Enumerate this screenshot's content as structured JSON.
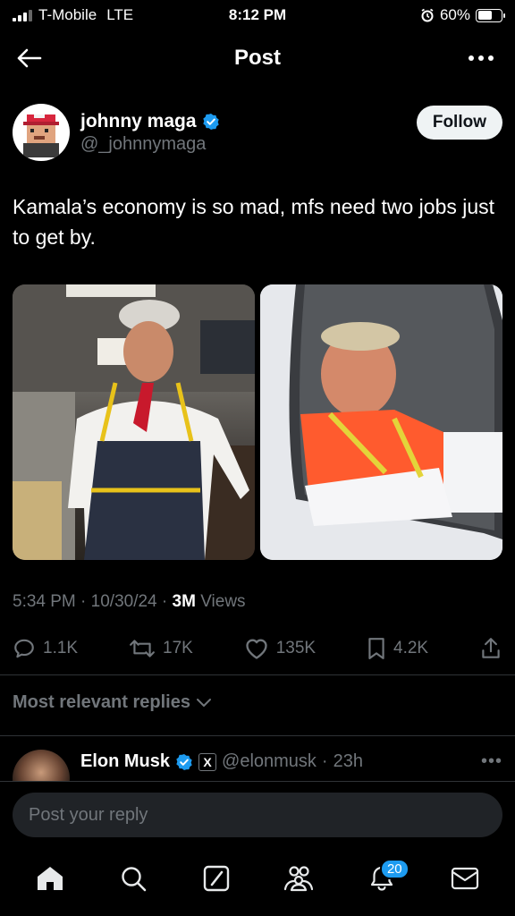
{
  "status_bar": {
    "carrier": "T-Mobile",
    "network": "LTE",
    "time": "8:12 PM",
    "battery": "60%",
    "battery_level": 0.6
  },
  "header": {
    "title": "Post",
    "back_icon": "arrow-left-icon",
    "more_icon": "more-horizontal-icon"
  },
  "author": {
    "name": "johnny maga",
    "handle": "@_johnnymaga",
    "verified": true,
    "follow_label": "Follow"
  },
  "post": {
    "text": "Kamala’s economy is so mad, mfs need two jobs just to get by.",
    "media_count": 2
  },
  "meta": {
    "time": "5:34 PM",
    "date": "10/30/24",
    "views_count": "3M",
    "views_label": "Views"
  },
  "actions": {
    "replies": "1.1K",
    "reposts": "17K",
    "likes": "135K",
    "bookmarks": "4.2K"
  },
  "replies_section": {
    "sort_label": "Most relevant replies"
  },
  "reply_preview": {
    "name": "Elon Musk",
    "handle": "@elonmusk",
    "age": "23h"
  },
  "composer": {
    "placeholder": "Post your reply"
  },
  "bottom_nav": {
    "notifications_count": "20"
  },
  "colors": {
    "background": "#000000",
    "accent": "#1d9bf0",
    "muted": "#71767b",
    "text": "#e7e9ea"
  }
}
